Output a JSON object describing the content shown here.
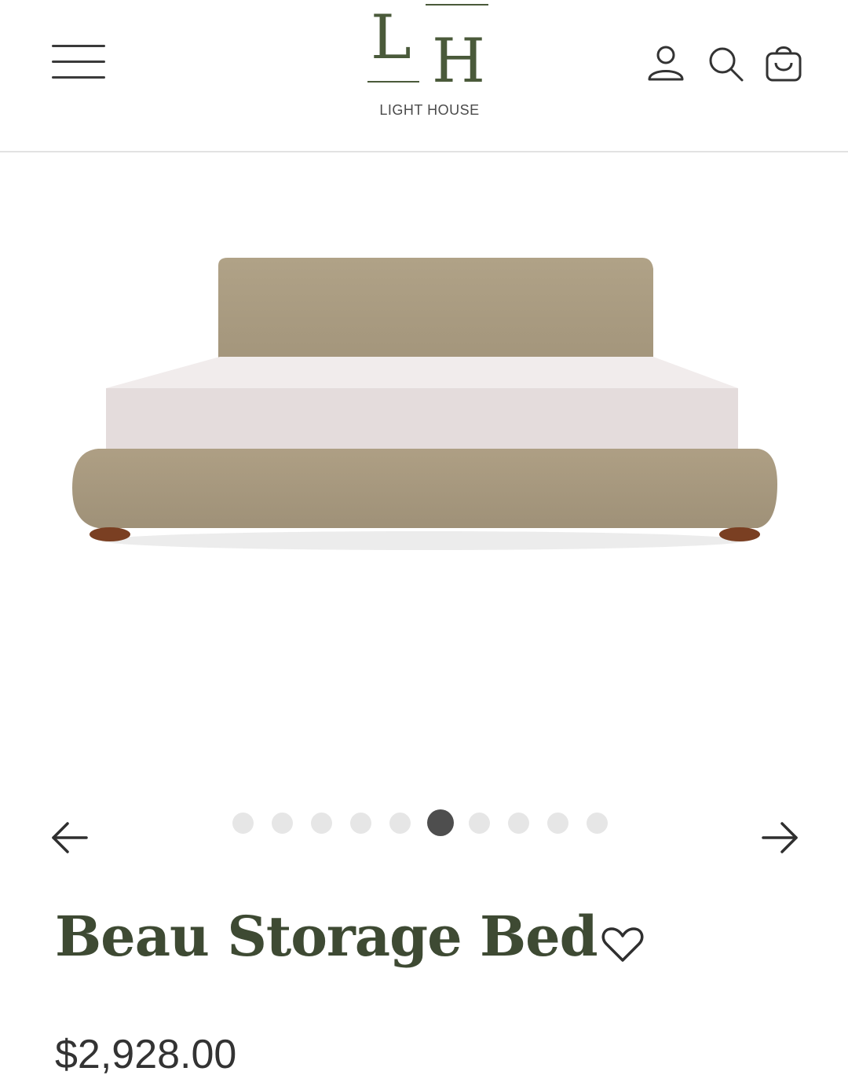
{
  "header": {
    "brand": {
      "monogram_left": "L",
      "monogram_right": "H",
      "name": "LIGHT HOUSE"
    },
    "icons": [
      "menu-icon",
      "account-icon",
      "search-icon",
      "cart-bag-icon"
    ]
  },
  "gallery": {
    "image_alt": "Beau Storage Bed",
    "slide_count": 10,
    "active_slide": 6,
    "prev_icon": "arrow-left-icon",
    "next_icon": "arrow-right-icon"
  },
  "product": {
    "title": "Beau Storage Bed",
    "price": "$2,928.00",
    "wishlist_icon": "heart-outline-icon"
  },
  "colors": {
    "title": "#3e4a33",
    "logo": "#4a5a3a",
    "upholstery": "#a89a80",
    "mattress": "#e4dcdc",
    "legs": "#7a3f22"
  }
}
